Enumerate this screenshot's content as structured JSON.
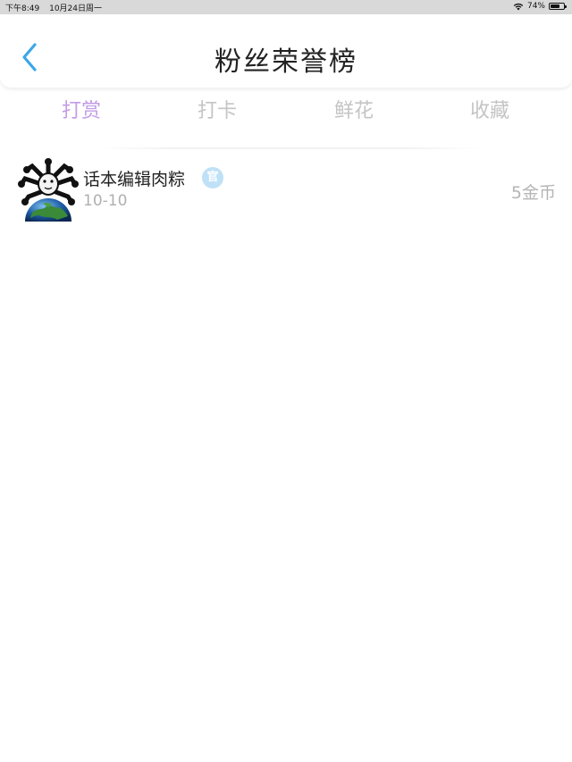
{
  "status_bar": {
    "time": "下午8:49",
    "date": "10月24日周一",
    "battery": "74%",
    "battery_level": 0.74
  },
  "header": {
    "title": "粉丝荣誉榜"
  },
  "tabs": [
    {
      "label": "打赏",
      "active": true
    },
    {
      "label": "打卡",
      "active": false
    },
    {
      "label": "鲜花",
      "active": false
    },
    {
      "label": "收藏",
      "active": false
    }
  ],
  "rank_list": [
    {
      "name": "话本编辑肉粽",
      "badge": "官",
      "date": "10-10",
      "amount": "5金币"
    }
  ],
  "colors": {
    "active_tab": "#c39ce6",
    "inactive_tab": "#c4c4c4",
    "back_arrow": "#3ba7e8",
    "badge_bg": "#bfe1f7"
  }
}
